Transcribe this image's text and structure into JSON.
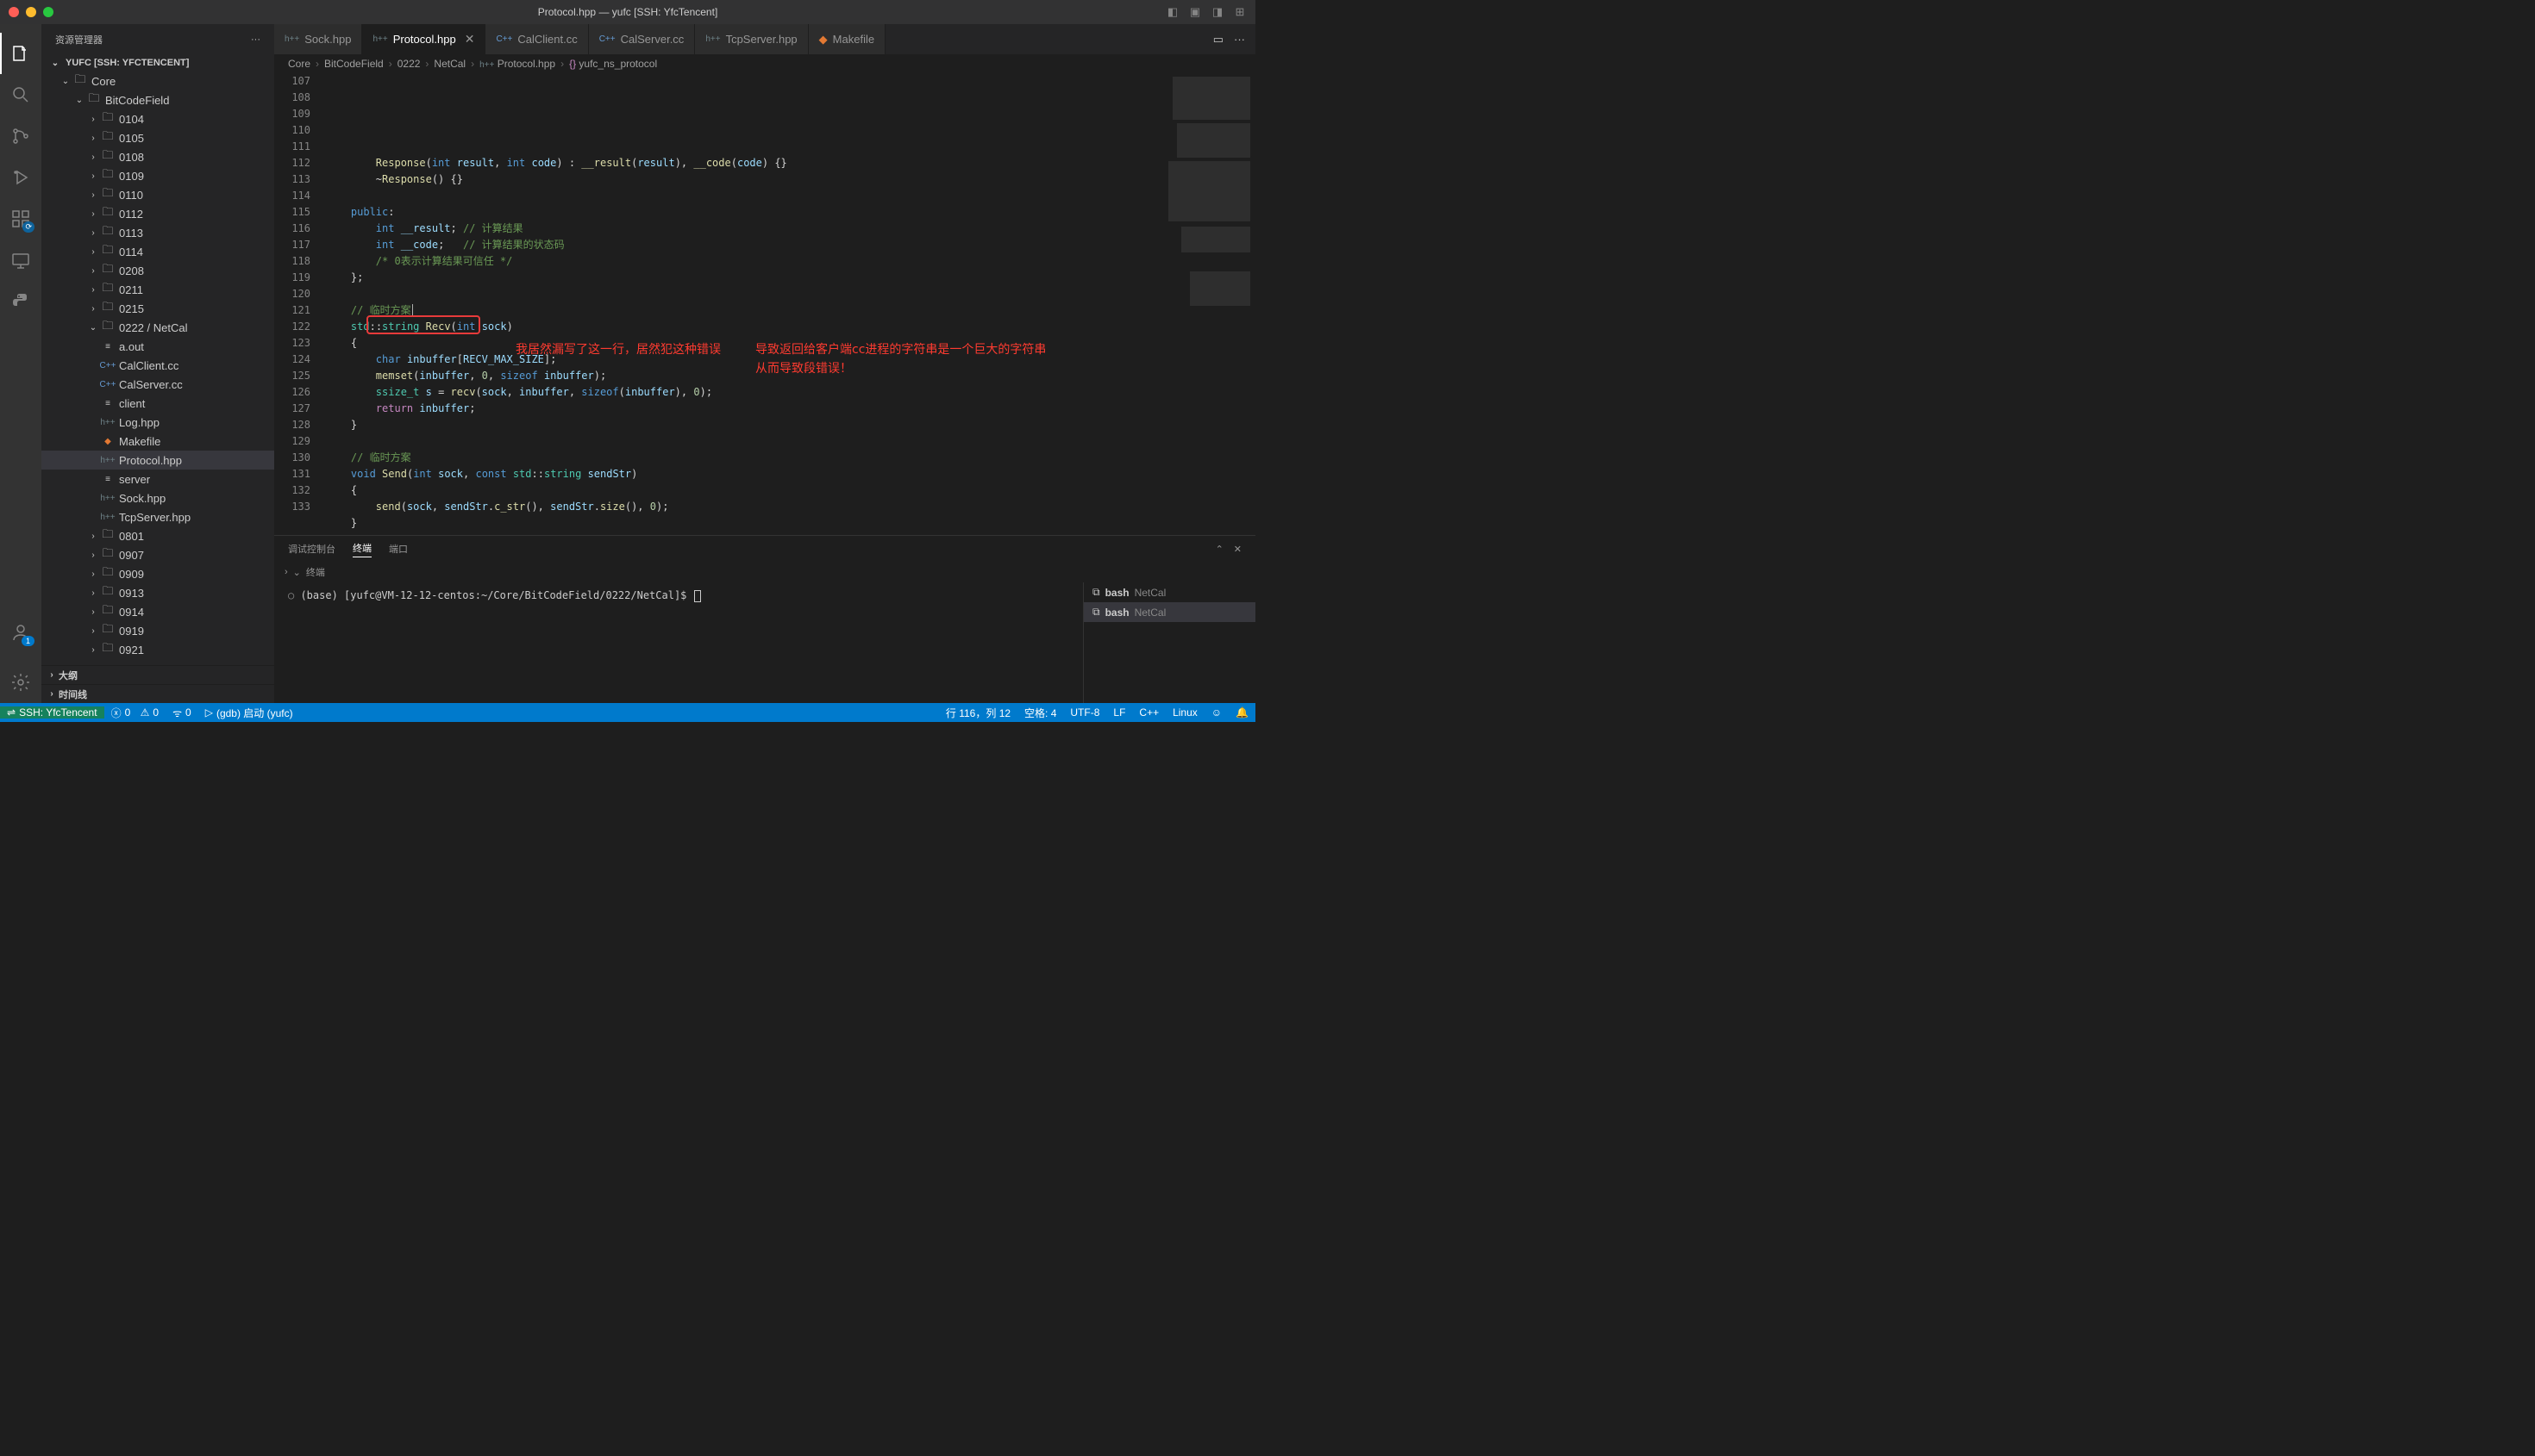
{
  "window": {
    "title": "Protocol.hpp — yufc [SSH: YfcTencent]"
  },
  "sidebar": {
    "title": "资源管理器",
    "root": "YUFC [SSH: YFCTENCENT]",
    "sections": {
      "outline": "大纲",
      "timeline": "时间线"
    },
    "tree": {
      "core": "Core",
      "bitcodefield": "BitCodeField",
      "folders1": [
        "0104",
        "0105",
        "0108",
        "0109",
        "0110",
        "0112",
        "0113",
        "0114",
        "0208",
        "0211",
        "0215"
      ],
      "netcal": "0222 / NetCal",
      "files": [
        "a.out",
        "CalClient.cc",
        "CalServer.cc",
        "client",
        "Log.hpp",
        "Makefile",
        "Protocol.hpp",
        "server",
        "Sock.hpp",
        "TcpServer.hpp"
      ],
      "folders2": [
        "0801",
        "0907",
        "0909",
        "0913",
        "0914",
        "0919",
        "0921"
      ]
    }
  },
  "tabs": [
    {
      "label": "Sock.hpp",
      "icon": "hpp"
    },
    {
      "label": "Protocol.hpp",
      "icon": "hpp",
      "active": true,
      "dirty": false
    },
    {
      "label": "CalClient.cc",
      "icon": "cpp"
    },
    {
      "label": "CalServer.cc",
      "icon": "cpp"
    },
    {
      "label": "TcpServer.hpp",
      "icon": "hpp"
    },
    {
      "label": "Makefile",
      "icon": "make"
    }
  ],
  "breadcrumb": [
    "Core",
    "BitCodeField",
    "0222",
    "NetCal",
    "Protocol.hpp",
    "yufc_ns_protocol"
  ],
  "code": {
    "lines": [
      107,
      108,
      109,
      110,
      111,
      112,
      113,
      114,
      115,
      116,
      117,
      118,
      119,
      120,
      121,
      122,
      123,
      124,
      125,
      126,
      127,
      128,
      129,
      130,
      131,
      132,
      133
    ],
    "annotations": {
      "a1": "我居然漏写了这一行，居然犯这种错误",
      "a2": "导致返回给客户端cc进程的字符串是一个巨大的字符串\n从而导致段错误！"
    }
  },
  "panel": {
    "tabs": {
      "debug": "调试控制台",
      "terminal": "终端",
      "ports": "端口"
    },
    "terminal_label": "终端",
    "prompt_prefix": "(base) [",
    "prompt_user": "yufc@VM-12-12-centos",
    "prompt_path": "~/Core/BitCodeField/0222/NetCal",
    "prompt_suffix": "]$ ",
    "tasks": [
      {
        "label": "bash",
        "detail": "NetCal"
      },
      {
        "label": "bash",
        "detail": "NetCal",
        "active": true
      }
    ]
  },
  "status": {
    "remote": "SSH: YfcTencent",
    "errors": "0",
    "warnings": "0",
    "ports": "0",
    "debug": "(gdb) 启动 (yufc)",
    "line_col": "行 116，列 12",
    "spaces": "空格: 4",
    "encoding": "UTF-8",
    "eol": "LF",
    "lang": "C++",
    "os": "Linux"
  }
}
